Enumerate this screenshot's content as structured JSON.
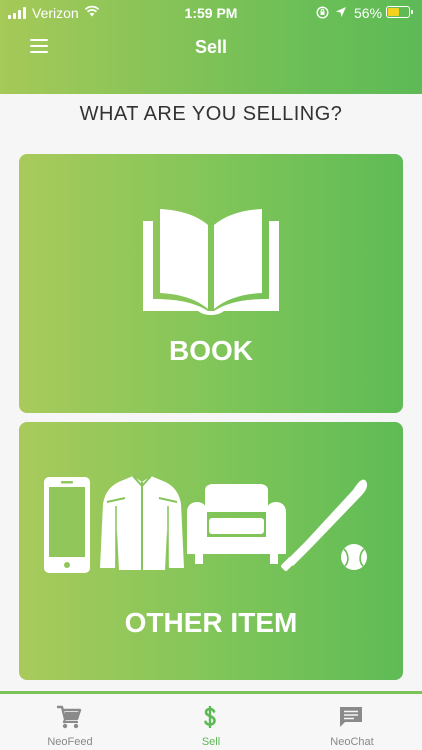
{
  "status_bar": {
    "carrier": "Verizon",
    "time": "1:59 PM",
    "battery_percent": "56%",
    "battery_level": 0.56,
    "battery_color": "#f5d21c"
  },
  "header": {
    "title": "Sell",
    "menu_icon": "hamburger-menu-icon",
    "gradient_colors": [
      "#a6c958",
      "#5dba56"
    ]
  },
  "main": {
    "heading": "WHAT ARE YOU SELLING?",
    "options": [
      {
        "label": "BOOK",
        "icons": [
          "open-book-icon"
        ]
      },
      {
        "label": "OTHER ITEM",
        "icons": [
          "smartphone-icon",
          "jacket-icon",
          "sofa-icon",
          "baseball-bat-icon"
        ]
      }
    ]
  },
  "tabbar": {
    "accent_color": "#5db856",
    "tabs": [
      {
        "label": "NeoFeed",
        "icon": "shopping-cart-icon",
        "active": false
      },
      {
        "label": "Sell",
        "icon": "dollar-sign-icon",
        "active": true
      },
      {
        "label": "NeoChat",
        "icon": "chat-bubble-icon",
        "active": false
      }
    ]
  }
}
